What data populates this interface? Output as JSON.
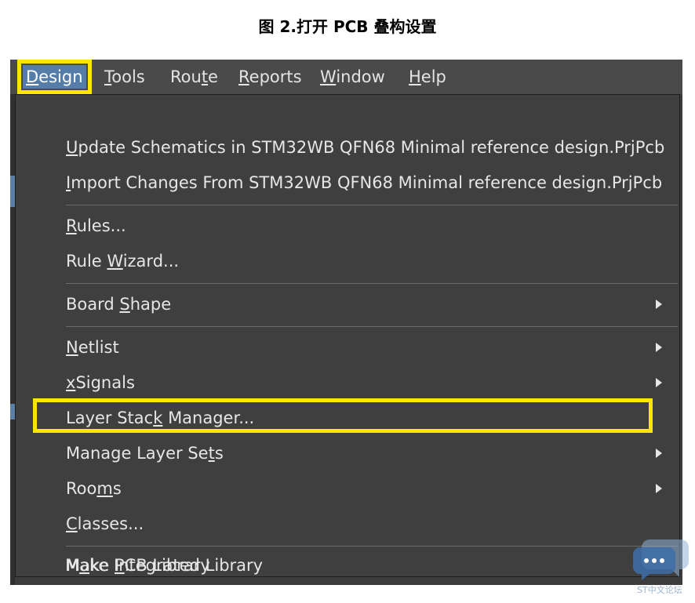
{
  "caption": "图 2.打开 PCB 叠构设置",
  "menubar": {
    "items": [
      {
        "pre": "",
        "u": "D",
        "post": "esign"
      },
      {
        "pre": "",
        "u": "T",
        "post": "ools"
      },
      {
        "pre": "Rou",
        "u": "t",
        "post": "e"
      },
      {
        "pre": "",
        "u": "R",
        "post": "eports"
      },
      {
        "pre": "",
        "u": "W",
        "post": "indow"
      },
      {
        "pre": "",
        "u": "H",
        "post": "elp"
      }
    ]
  },
  "design_menu": {
    "items": [
      {
        "pre": "",
        "u": "U",
        "post": "pdate Schematics in STM32WB QFN68 Minimal  reference design.PrjPcb"
      },
      {
        "pre": "",
        "u": "I",
        "post": "mport Changes From STM32WB QFN68 Minimal  reference design.PrjPcb"
      },
      {
        "pre": "",
        "u": "R",
        "post": "ules..."
      },
      {
        "pre": "Rule ",
        "u": "W",
        "post": "izard..."
      },
      {
        "pre": "Board ",
        "u": "S",
        "post": "hape"
      },
      {
        "pre": "",
        "u": "N",
        "post": "etlist"
      },
      {
        "pre": "",
        "u": "x",
        "post": "Signals"
      },
      {
        "pre": "Layer Stac",
        "u": "k",
        "post": " Manager..."
      },
      {
        "pre": "Manage Layer Se",
        "u": "t",
        "post": "s"
      },
      {
        "pre": "Roo",
        "u": "m",
        "post": "s"
      },
      {
        "pre": "",
        "u": "C",
        "post": "lasses..."
      },
      {
        "pre": "Make ",
        "u": "P",
        "post": "CB Library"
      },
      {
        "pre": "M",
        "u": "a",
        "post": "ke Integrated Library"
      }
    ]
  },
  "watermark": "ST中文论坛",
  "colors": {
    "highlight": "#ffe600",
    "active_menu": "#557da8",
    "menu_bg": "#3f3f3f"
  }
}
